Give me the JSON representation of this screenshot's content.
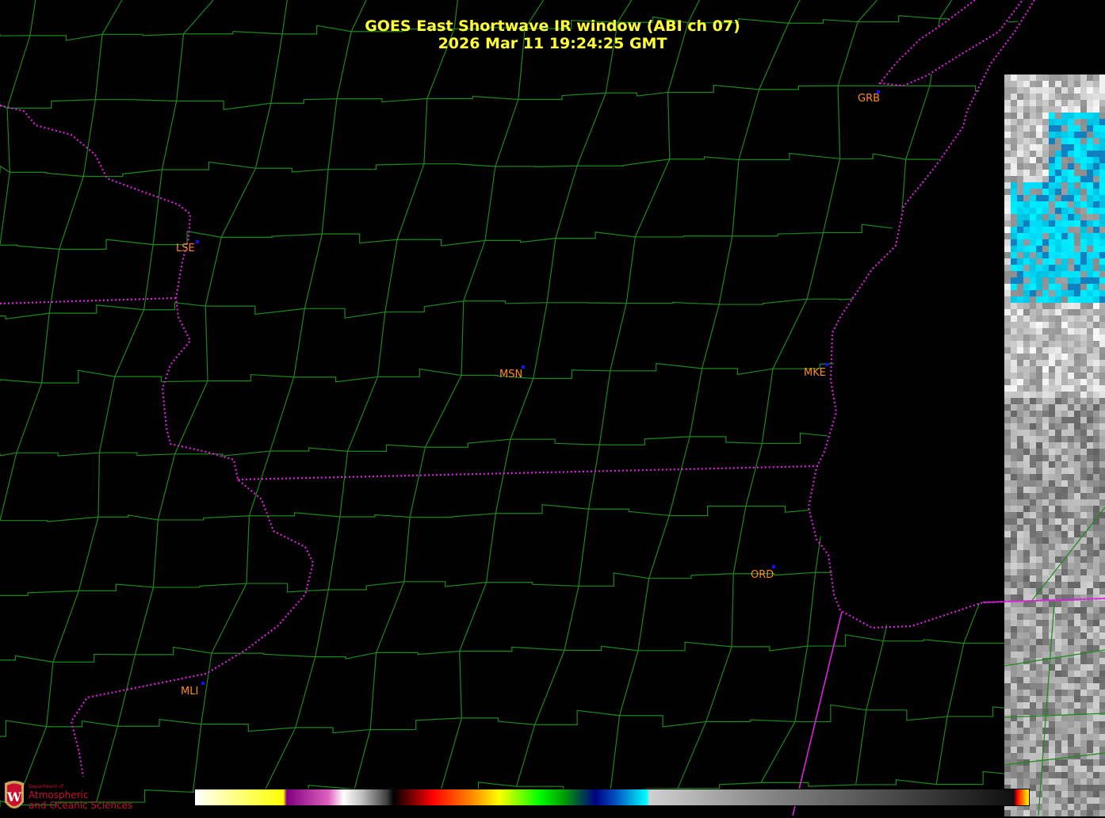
{
  "title": {
    "line1": "GOES East Shortwave IR window (ABI ch 07)",
    "line2": "2026 Mar 11  19:24:25 GMT"
  },
  "cities": [
    {
      "code": "GRB"
    },
    {
      "code": "LSE"
    },
    {
      "code": "MSN"
    },
    {
      "code": "MKE"
    },
    {
      "code": "ORD"
    },
    {
      "code": "MLI"
    }
  ],
  "logo": {
    "line1": "Department of",
    "line2": "Atmospheric",
    "line3": "and Oceanic Sciences"
  },
  "colors": {
    "county_lines": "#1a8a1a",
    "state_borders": "#e020e0",
    "title": "#ffff33",
    "city_labels": "#ff8c1a",
    "station_dots": "#1010ff"
  }
}
